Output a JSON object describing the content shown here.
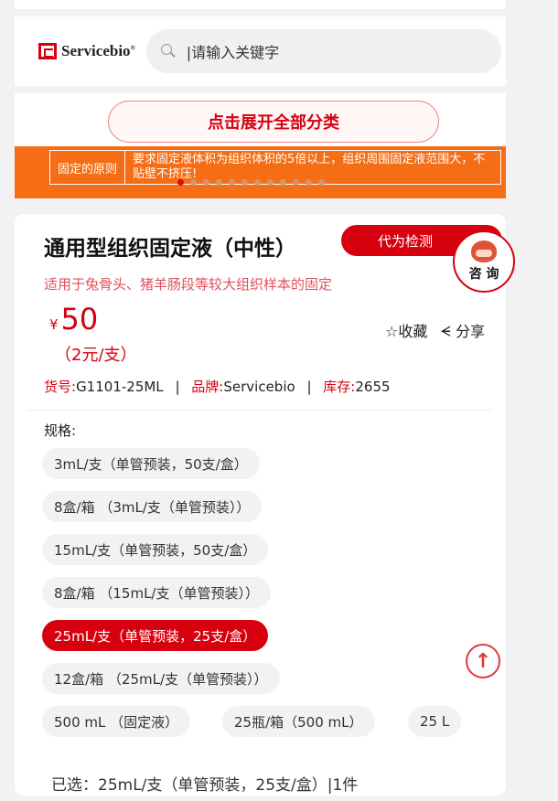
{
  "header": {
    "logo_text": "Servicebio",
    "logo_reg": "®",
    "search_placeholder": "|请输入关键字"
  },
  "category": {
    "expand_label": "点击展开全部分类",
    "banner": {
      "key": "固定的原则",
      "value": "要求固定液体积为组织体积的5倍以上，组织周围固定液范围大，不贴壁不挤压!"
    },
    "dots_total": 12,
    "dots_active": 0
  },
  "product": {
    "title": "通用型组织固定液（中性）",
    "detect_label": "代为检测",
    "consult_label": "咨 询",
    "subtitle": "适用于兔骨头、猪羊肠段等较大组织样本的固定",
    "currency": "¥",
    "price": "50",
    "unit_price": "（2元/支）",
    "favorite_label": "☆收藏",
    "share_label": "分享",
    "meta": {
      "sku_label": "货号:",
      "sku": "G1101-25ML",
      "brand_label": "品牌:",
      "brand": "Servicebio",
      "stock_label": "库存:",
      "stock": "2655",
      "separator": "|"
    },
    "spec_label": "规格:",
    "specs": [
      "3mL/支（单管预装，50支/盒）",
      "8盒/箱 （3mL/支（单管预装））",
      "15mL/支（单管预装，50支/盒）",
      "8盒/箱 （15mL/支（单管预装））",
      "25mL/支（单管预装，25支/盒）",
      "12盒/箱 （25mL/支（单管预装））",
      "500 mL （固定液）",
      "25瓶/箱（500 mL）",
      "25 L"
    ],
    "selected_spec_index": 4,
    "selected_text": "已选：25mL/支（单管预装，25支/盒）|1件"
  },
  "colors": {
    "brand_red": "#d7000f",
    "banner_orange": "#f56d15"
  }
}
